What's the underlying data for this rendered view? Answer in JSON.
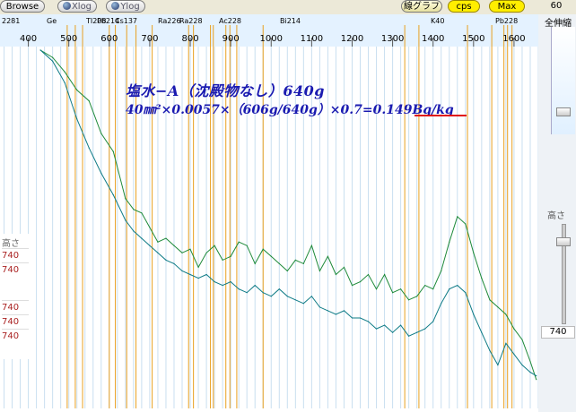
{
  "toolbar": {
    "browse": "Browse",
    "xlog": "Xlog",
    "ylog": "Ylog",
    "line_graph": "線グラフ",
    "cps": "cps",
    "max": "Max",
    "time_value": "60"
  },
  "nuclide_labels": [
    "2281",
    "Ge",
    "TI208",
    "Pb214",
    "Cs137",
    "Ra226",
    "Ra228",
    "Ac228",
    "Bi214",
    "K40",
    "Pb228"
  ],
  "annotation": {
    "line1": "塩水−A（沈殿物なし）640g",
    "line2": "40㎜²×0.0057×（606g/640g）×0.7=0.149Bq/kg"
  },
  "height_panel": {
    "label": "高さ",
    "values": [
      "740",
      "740",
      "740",
      "740",
      "740"
    ]
  },
  "right_panel": {
    "zoom_all_label": "全伸縮",
    "height_label": "高さ",
    "height_value": "740"
  },
  "chart_data": {
    "type": "line",
    "x_ticks": [
      400,
      500,
      600,
      700,
      800,
      900,
      1000,
      1100,
      1200,
      1300,
      1400,
      1500,
      1600
    ],
    "xlim": [
      330,
      1660
    ],
    "ylim": [
      0,
      1
    ],
    "marker_lines_x": [
      496,
      516,
      534,
      600,
      615,
      643,
      666,
      706,
      796,
      808,
      850,
      857,
      888,
      898,
      915,
      980,
      1330,
      1365,
      1485,
      1545,
      1575,
      1584,
      1595
    ],
    "series": [
      {
        "color": "#1e8a3a",
        "x": [
          430,
          460,
          490,
          520,
          550,
          580,
          610,
          640,
          660,
          680,
          700,
          720,
          740,
          760,
          780,
          800,
          820,
          840,
          860,
          880,
          900,
          920,
          940,
          960,
          980,
          1000,
          1020,
          1040,
          1060,
          1080,
          1100,
          1120,
          1140,
          1160,
          1180,
          1200,
          1220,
          1240,
          1260,
          1280,
          1300,
          1320,
          1340,
          1360,
          1380,
          1400,
          1420,
          1440,
          1460,
          1480,
          1500,
          1520,
          1540,
          1560,
          1580,
          1600,
          1620,
          1640,
          1655
        ],
        "y": [
          0.99,
          0.97,
          0.93,
          0.88,
          0.85,
          0.76,
          0.71,
          0.58,
          0.55,
          0.54,
          0.5,
          0.46,
          0.47,
          0.45,
          0.43,
          0.44,
          0.39,
          0.43,
          0.45,
          0.41,
          0.42,
          0.46,
          0.45,
          0.4,
          0.44,
          0.42,
          0.4,
          0.38,
          0.41,
          0.4,
          0.45,
          0.38,
          0.42,
          0.37,
          0.39,
          0.34,
          0.35,
          0.37,
          0.33,
          0.37,
          0.32,
          0.33,
          0.3,
          0.31,
          0.34,
          0.33,
          0.38,
          0.46,
          0.53,
          0.51,
          0.43,
          0.36,
          0.3,
          0.28,
          0.26,
          0.22,
          0.19,
          0.13,
          0.08
        ]
      },
      {
        "color": "#0e7b86",
        "x": [
          430,
          460,
          490,
          520,
          550,
          580,
          610,
          640,
          660,
          680,
          700,
          720,
          740,
          760,
          780,
          800,
          820,
          840,
          860,
          880,
          900,
          920,
          940,
          960,
          980,
          1000,
          1020,
          1040,
          1060,
          1080,
          1100,
          1120,
          1140,
          1160,
          1180,
          1200,
          1220,
          1240,
          1260,
          1280,
          1300,
          1320,
          1340,
          1360,
          1380,
          1400,
          1420,
          1440,
          1460,
          1480,
          1500,
          1520,
          1540,
          1560,
          1580,
          1600,
          1620,
          1640,
          1655
        ],
        "y": [
          0.99,
          0.96,
          0.9,
          0.8,
          0.72,
          0.65,
          0.59,
          0.52,
          0.49,
          0.47,
          0.45,
          0.43,
          0.41,
          0.4,
          0.38,
          0.37,
          0.36,
          0.37,
          0.35,
          0.34,
          0.35,
          0.33,
          0.32,
          0.34,
          0.32,
          0.31,
          0.33,
          0.31,
          0.3,
          0.29,
          0.31,
          0.28,
          0.27,
          0.26,
          0.27,
          0.25,
          0.25,
          0.24,
          0.22,
          0.23,
          0.21,
          0.23,
          0.2,
          0.21,
          0.22,
          0.24,
          0.29,
          0.33,
          0.34,
          0.32,
          0.26,
          0.21,
          0.16,
          0.12,
          0.18,
          0.15,
          0.12,
          0.1,
          0.09
        ]
      }
    ]
  }
}
